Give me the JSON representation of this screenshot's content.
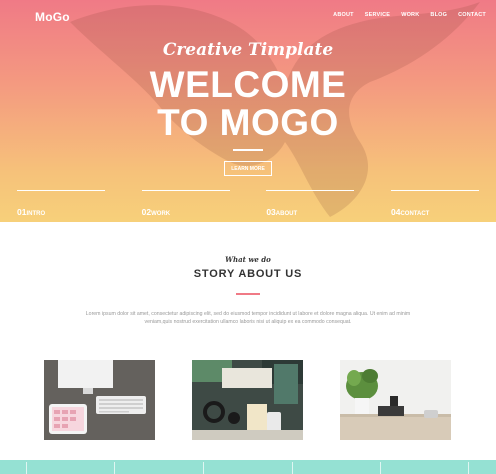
{
  "header": {
    "logo": "MoGo",
    "nav": [
      "ABOUT",
      "SERVICE",
      "WORK",
      "BLOG",
      "CONTACT"
    ]
  },
  "hero": {
    "kicker": "Creative Timplate",
    "title_line1": "WELCOME",
    "title_line2": "TO MOGO",
    "button_label": "LEARN MORE",
    "tabs": [
      {
        "num": "01",
        "label": "INTRO"
      },
      {
        "num": "02",
        "label": "WORK"
      },
      {
        "num": "03",
        "label": "ABOUT"
      },
      {
        "num": "04",
        "label": "CONTACT"
      }
    ]
  },
  "about": {
    "kicker": "What we do",
    "title": "STORY ABOUT US",
    "text_line1": "Lorem ipsum dolor sit amet, consectetur adipiscing elit, sed do eiusmod tempor incididunt ut labore et dolore magna aliqua. Ut enim ad minim",
    "text_line2": "veniam,quis nostrud exercitation ullamco laboris nisi ut aliquip ex ea commodo consequat."
  },
  "colors": {
    "hero_top": "#f07a86",
    "hero_bottom": "#f7d07a",
    "accent": "#f07a86",
    "footer_strip": "#95e1d3"
  },
  "icons": [
    "eagle-watermark"
  ]
}
